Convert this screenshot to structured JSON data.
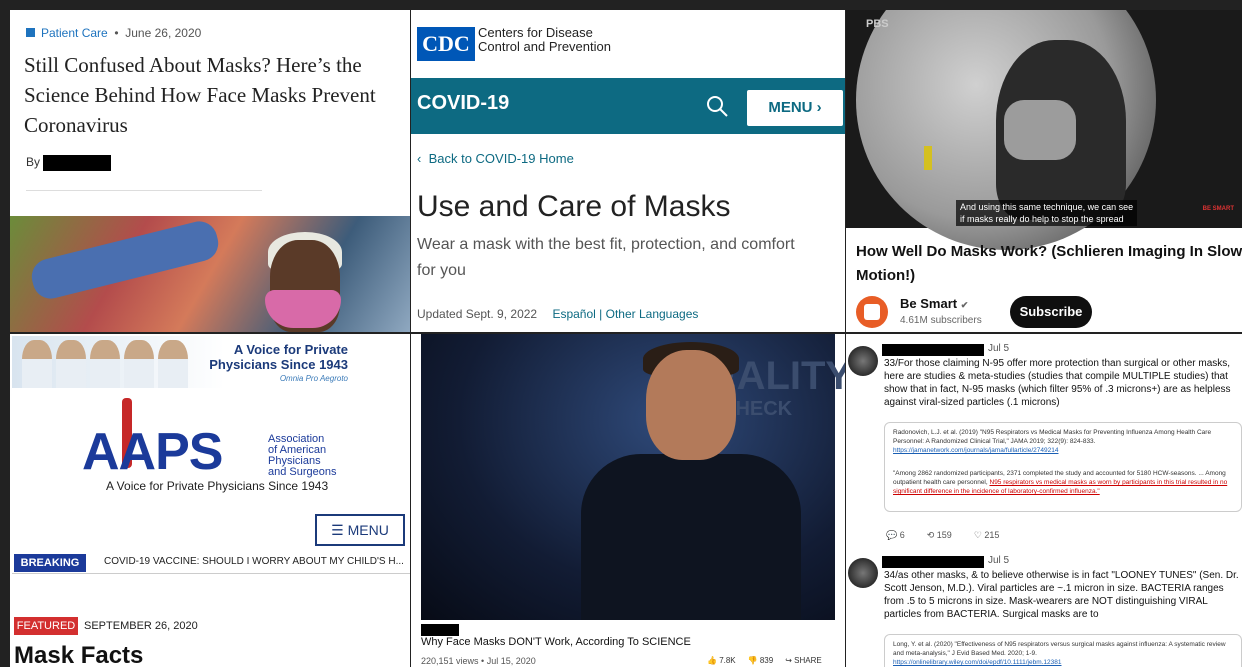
{
  "panel1": {
    "category": "Patient Care",
    "date": "June 26, 2020",
    "title": "Still Confused About Masks? Here’s the Science Behind How Face Masks Prevent Coronavirus",
    "by": "By"
  },
  "panel2": {
    "logo": "CDC",
    "org_line1": "Centers for Disease",
    "org_line2": "Control and Prevention",
    "section": "COVID-19",
    "menu_label": "MENU",
    "menu_chevron": "›",
    "back_link": "Back to COVID-19 Home",
    "back_chevron": "‹",
    "heading": "Use and Care of Masks",
    "subheading": "Wear a mask with the best fit, protection, and comfort for you",
    "updated": "Updated Sept. 9, 2022",
    "lang_espanol": "Español",
    "lang_sep": "|",
    "lang_other": "Other Languages"
  },
  "panel3": {
    "network": "PBS",
    "caption_line1": "And using this same technique, we can see",
    "caption_line2": "if masks really do help to stop the spread",
    "watermark": "BE SMART",
    "title": "How Well Do Masks Work? (Schlieren Imaging In Slow Motion!)",
    "channel": "Be Smart",
    "verified_icon": "✔",
    "subscribers": "4.61M subscribers",
    "subscribe_label": "Subscribe"
  },
  "panel4": {
    "banner_line1": "A Voice for Private",
    "banner_line2": "Physicians Since 1943",
    "motto": "Omnia Pro Aegroto",
    "logo": "AAPS",
    "assoc_line1": "Association",
    "assoc_line2": "of American",
    "assoc_line3": "Physicians",
    "assoc_line4": "and Surgeons",
    "tagline": "A Voice for Private Physicians Since 1943",
    "menu_icon": "☰",
    "menu_label": "MENU",
    "breaking": "BREAKING",
    "ticker": "COVID-19 VACCINE: SHOULD I WORRY ABOUT MY CHILD'S H...",
    "featured": "FEATURED",
    "featured_date": "SEPTEMBER 26, 2020",
    "heading": "Mask Facts"
  },
  "panel5": {
    "overlay_word1": "REALITY",
    "overlay_word2": "CHECK",
    "title": "Why Face Masks DON'T Work, According To SCIENCE",
    "views": "220,151 views • Jul 15, 2020",
    "likes": "7.8K",
    "dislikes": "839",
    "share": "SHARE"
  },
  "panel6": {
    "tweet1": {
      "date": "Jul 5",
      "text": "33/For those claiming N-95 offer more protection than surgical or other masks, here are studies & meta-studies (studies that compile MULTIPLE studies) that show that in fact, N-95 masks (which filter 95% of .3 microns+) are as helpless against viral-sized particles (.1 microns)",
      "card_cite": "Radonovich, L.J. et al. (2019) \"N95 Respirators vs Medical Masks for Preventing Influenza Among Health Care Personnel: A Randomized Clinical Trial,\" JAMA 2019; 322(9): 824-833.",
      "card_link": "https://jamanetwork.com/journals/jama/fullarticle/2749214",
      "card_quote": "\"Among 2862 randomized participants, 2371 completed the study and accounted for 5180 HCW-seasons. ... Among outpatient health care personnel,",
      "card_highlight": "N95 respirators vs medical masks as worn by participants in this trial resulted in no significant difference in the incidence of laboratory-confirmed influenza.\"",
      "replies": "6",
      "retweets": "159",
      "likes": "215"
    },
    "tweet2": {
      "date": "Jul 5",
      "text": "34/as other masks, & to believe otherwise is in fact \"LOONEY TUNES\" (Sen. Dr. Scott Jenson, M.D.). Viral particles are ~.1 micron in size. BACTERIA ranges from .5 to 5 microns in size. Mask-wearers are NOT distinguishing VIRAL particles from BACTERIA. Surgical masks are to",
      "card_cite": "Long, Y. et al. (2020) \"Effectiveness of N95 respirators versus surgical masks against influenza: A systematic review and meta-analysis,\" J Evid Based Med. 2020; 1-9.",
      "card_link": "https://onlinelibrary.wiley.com/doi/epdf/10.1111/jebm.12381"
    }
  }
}
